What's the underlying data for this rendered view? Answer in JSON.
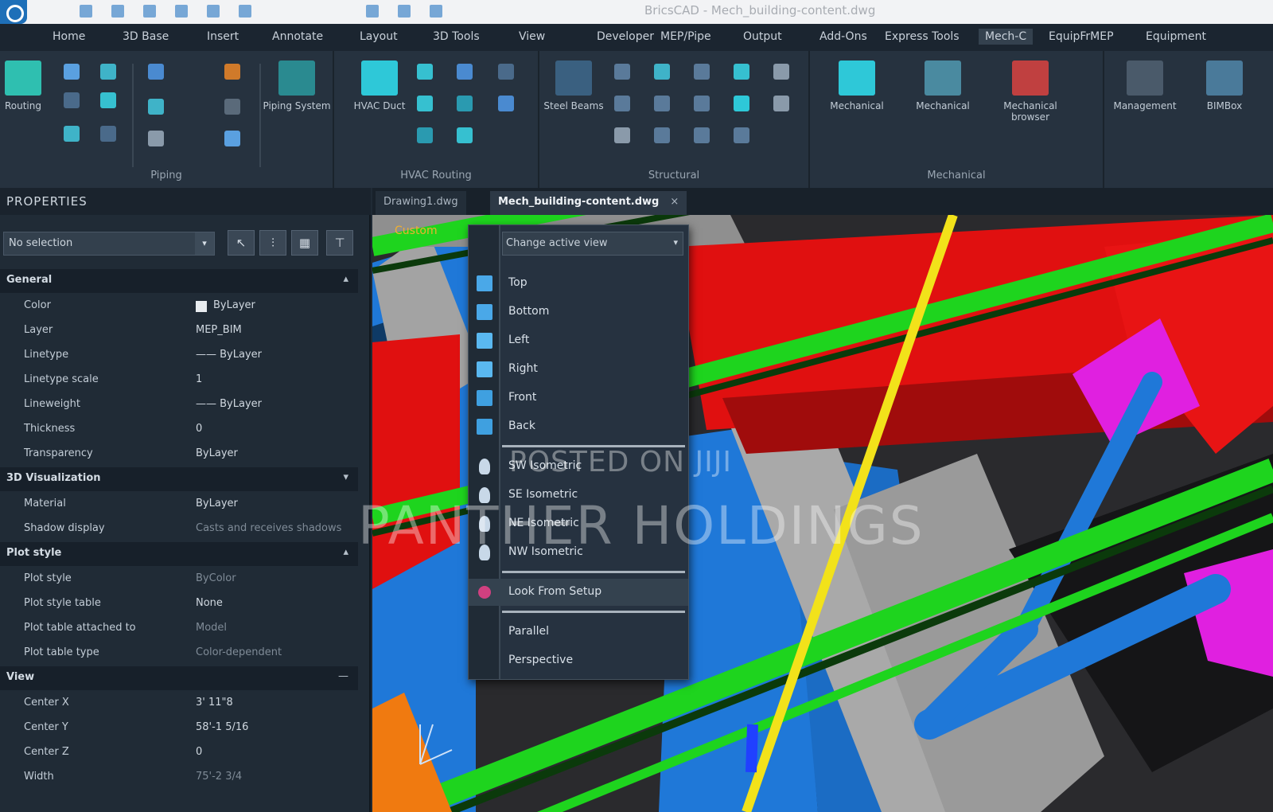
{
  "titlebar": {
    "window_title": "BricsCAD - Mech_building-content.dwg"
  },
  "menu": {
    "tabs": [
      "Home",
      "3D Base",
      "Insert",
      "Annotate",
      "Layout",
      "3D Tools",
      "View",
      "Developer",
      "MEP/Pipe",
      "Output",
      "Add-Ons",
      "Express Tools",
      "Mech-C",
      "EquipFrMEP",
      "Equipment"
    ],
    "active_index": 12
  },
  "ribbon": {
    "panels": [
      {
        "title": "Piping",
        "tools": [
          "Routing",
          "Piping System"
        ]
      },
      {
        "title": "HVAC Routing",
        "tools": [
          "HVAC Duct"
        ]
      },
      {
        "title": "Structural",
        "tools": [
          "Steel Beams"
        ]
      },
      {
        "title": "Mechanical",
        "tools": [
          "Mechanical",
          "Mechanical",
          "Mechanical browser"
        ]
      },
      {
        "title": "",
        "tools": [
          "Management",
          "BIMBox"
        ]
      }
    ]
  },
  "properties": {
    "title": "PROPERTIES",
    "selection": "No selection",
    "buttons": [
      "select-icon",
      "filter-icon",
      "list-icon",
      "pin-icon"
    ],
    "sections": [
      {
        "label": "General",
        "caret": "▴",
        "rows": [
          {
            "key": "Color",
            "value": "ByLayer"
          },
          {
            "key": "Layer",
            "value": "MEP_BIM"
          },
          {
            "key": "Linetype",
            "value": "—— ByLayer"
          },
          {
            "key": "Linetype scale",
            "value": "1"
          },
          {
            "key": "Lineweight",
            "value": "—— ByLayer"
          },
          {
            "key": "Thickness",
            "value": "0"
          },
          {
            "key": "Transparency",
            "value": "ByLayer"
          }
        ]
      },
      {
        "label": "3D Visualization",
        "caret": "▾",
        "rows": [
          {
            "key": "Material",
            "value": "ByLayer"
          },
          {
            "key": "Shadow display",
            "value": "Casts and receives shadows",
            "dim": true
          }
        ]
      },
      {
        "label": "Plot style",
        "caret": "▴",
        "rows": [
          {
            "key": "Plot style",
            "value": "ByColor",
            "dim": true
          },
          {
            "key": "Plot style table",
            "value": "None"
          },
          {
            "key": "Plot table attached to",
            "value": "Model",
            "dim": true
          },
          {
            "key": "Plot table type",
            "value": "Color-dependent",
            "dim": true
          }
        ]
      },
      {
        "label": "View",
        "caret": "—",
        "rows": [
          {
            "key": "Center X",
            "value": "3' 11\"8"
          },
          {
            "key": "Center Y",
            "value": "58'-1 5/16"
          },
          {
            "key": "Center Z",
            "value": "0"
          },
          {
            "key": "Width",
            "value": "75'-2 3/4",
            "dim": true
          }
        ]
      }
    ]
  },
  "doc_tabs": [
    {
      "label": "Drawing1.dwg"
    },
    {
      "label": "Mech_building-content.dwg",
      "close": "×"
    }
  ],
  "viewport": {
    "label": "Custom"
  },
  "context_menu": {
    "header": "Change active view",
    "header_arrow": "▾",
    "groups": [
      [
        {
          "label": "Top",
          "icon": "view-top-icon"
        },
        {
          "label": "Bottom",
          "icon": "view-bottom-icon"
        },
        {
          "label": "Left",
          "icon": "view-left-icon"
        },
        {
          "label": "Right",
          "icon": "view-right-icon"
        },
        {
          "label": "Front",
          "icon": "view-front-icon"
        },
        {
          "label": "Back",
          "icon": "view-back-icon"
        }
      ],
      [
        {
          "label": "SW Isometric",
          "icon": "view-sw-iso-icon"
        },
        {
          "label": "SE Isometric",
          "icon": "view-se-iso-icon"
        },
        {
          "label": "NE Isometric",
          "icon": "view-ne-iso-icon"
        },
        {
          "label": "NW Isometric",
          "icon": "view-nw-iso-icon"
        }
      ],
      [
        {
          "label": "Look From Setup",
          "icon": "look-from-icon",
          "highlight": true
        }
      ],
      [
        {
          "label": "Parallel",
          "icon": ""
        },
        {
          "label": "Perspective",
          "icon": ""
        }
      ]
    ]
  },
  "watermark": {
    "line1": "POSTED ON JIJI",
    "line2": "PANTHER HOLDINGS"
  },
  "colors": {
    "accent": "#1e6fb8",
    "pipe_blue": "#1f78d8",
    "beam_green": "#1ed41e",
    "wall_red": "#e01010",
    "magenta": "#e020e0",
    "yellow": "#f2e21a",
    "concrete": "#a3a3a3"
  }
}
